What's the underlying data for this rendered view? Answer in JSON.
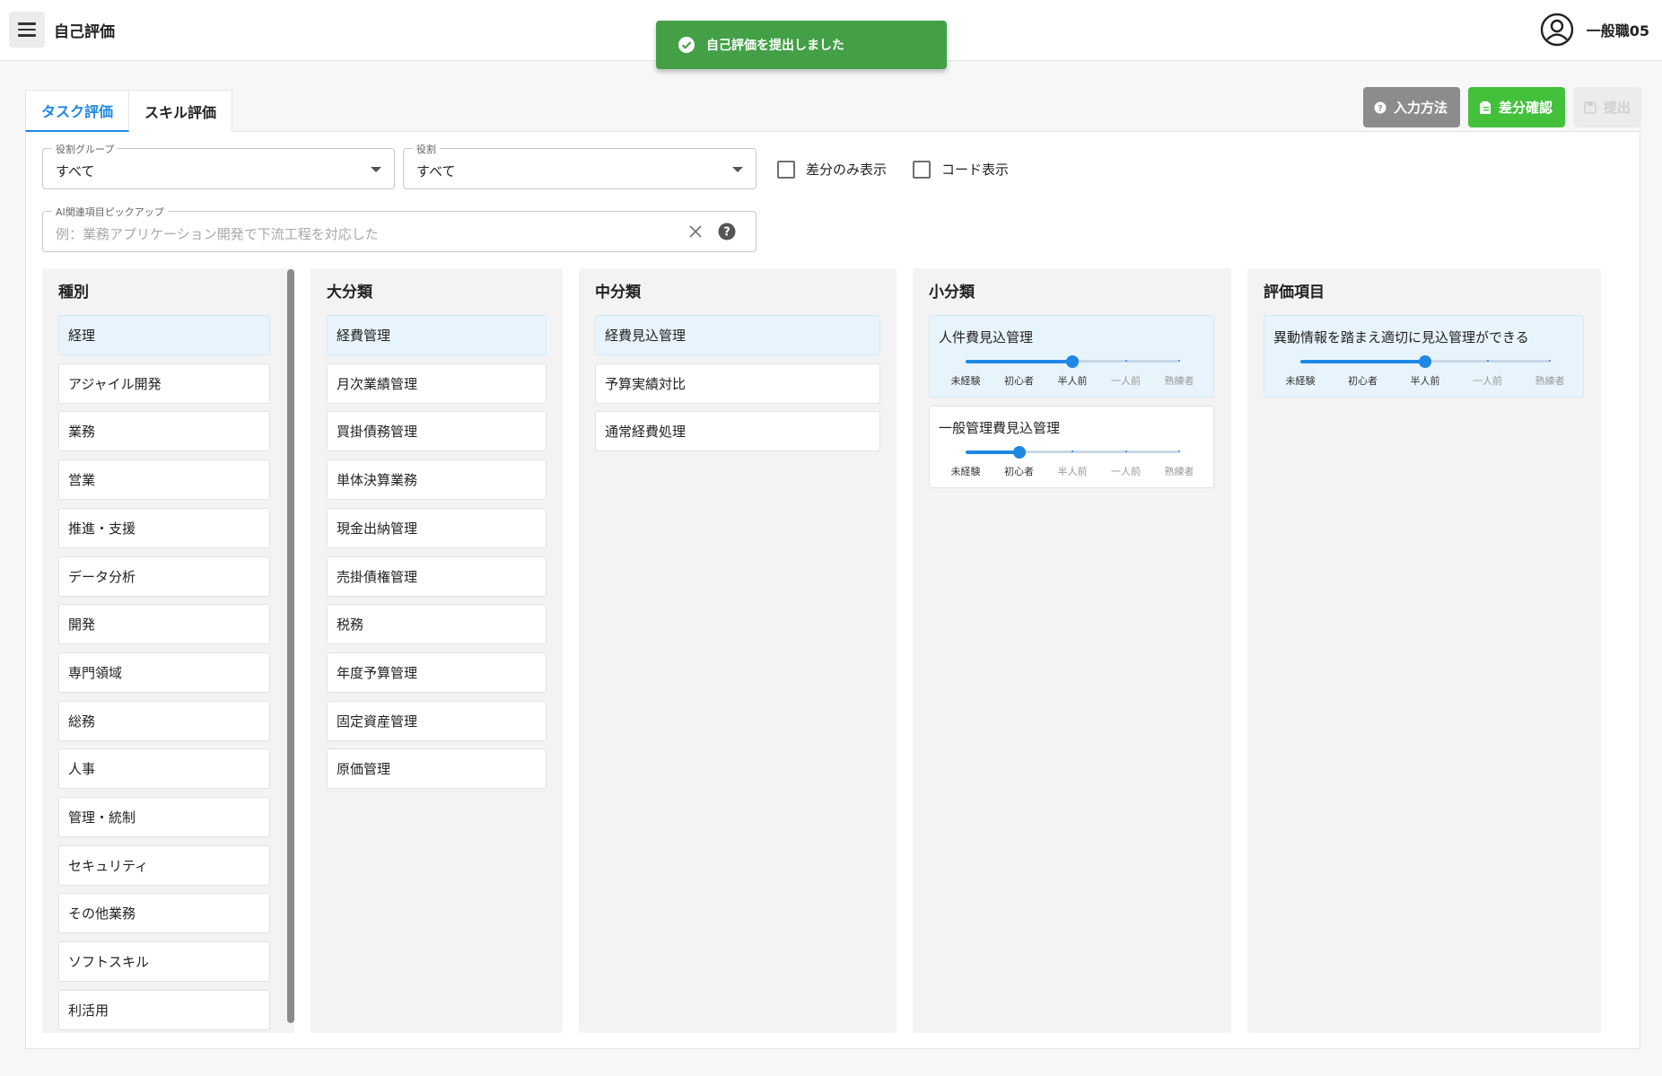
{
  "header": {
    "title": "自己評価",
    "user_name": "一般職05"
  },
  "snackbar": {
    "message": "自己評価を提出しました",
    "color": "#43a047"
  },
  "tabs": [
    {
      "label": "タスク評価",
      "active": true
    },
    {
      "label": "スキル評価",
      "active": false
    }
  ],
  "toolbar": {
    "howto_label": "入力方法",
    "diff_label": "差分確認",
    "submit_label": "提出"
  },
  "filters": {
    "role_group": {
      "label": "役割グループ",
      "value": "すべて"
    },
    "role": {
      "label": "役割",
      "value": "すべて"
    },
    "diff_only_label": "差分のみ表示",
    "code_display_label": "コード表示",
    "ai_pickup": {
      "label": "AI関連項目ピックアップ",
      "placeholder": "例：業務アプリケーション開発で下流工程を対応した"
    }
  },
  "columns": {
    "kind": {
      "title": "種別",
      "items": [
        "経理",
        "アジャイル開発",
        "業務",
        "営業",
        "推進・支援",
        "データ分析",
        "開発",
        "専門領域",
        "総務",
        "人事",
        "管理・統制",
        "セキュリティ",
        "その他業務",
        "ソフトスキル",
        "利活用"
      ],
      "selected": 0
    },
    "major": {
      "title": "大分類",
      "items": [
        "経費管理",
        "月次業績管理",
        "買掛債務管理",
        "単体決算業務",
        "現金出納管理",
        "売掛債権管理",
        "税務",
        "年度予算管理",
        "固定資産管理",
        "原価管理"
      ],
      "selected": 0
    },
    "middle": {
      "title": "中分類",
      "items": [
        "経費見込管理",
        "予算実績対比",
        "通常経費処理"
      ],
      "selected": 0
    },
    "minor": {
      "title": "小分類",
      "items": [
        {
          "label": "人件費見込管理",
          "level": 2
        },
        {
          "label": "一般管理費見込管理",
          "level": 1
        }
      ]
    },
    "eval": {
      "title": "評価項目",
      "items": [
        {
          "label": "異動情報を踏まえ適切に見込管理ができる",
          "level": 2
        }
      ]
    }
  },
  "levels": [
    "未経験",
    "初心者",
    "半人前",
    "一人前",
    "熟練者"
  ]
}
